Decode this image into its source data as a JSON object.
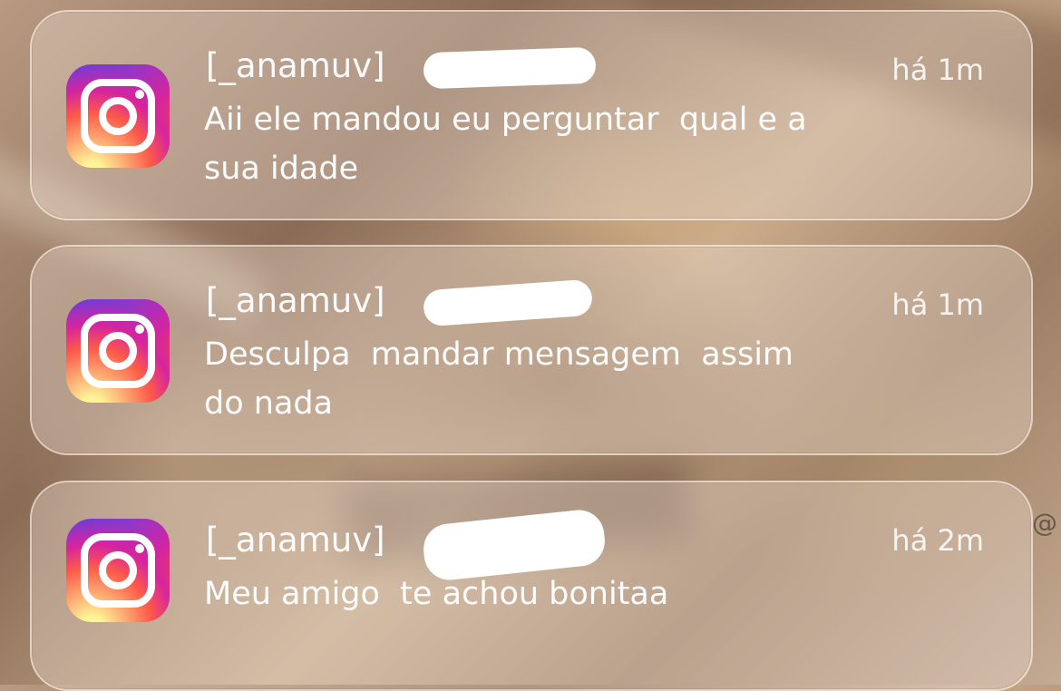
{
  "notifications": [
    {
      "app_icon": "instagram-icon",
      "sender": "[_anamuv]",
      "time": "há 1m",
      "message": "Aii ele mandou eu perguntar  qual e a\nsua idade"
    },
    {
      "app_icon": "instagram-icon",
      "sender": "[_anamuv]",
      "time": "há 1m",
      "message": "Desculpa  mandar mensagem  assim\ndo nada"
    },
    {
      "app_icon": "instagram-icon",
      "sender": "[_anamuv]",
      "time": "há 2m",
      "message": "Meu amigo  te achou bonitaa"
    }
  ],
  "edge_glyph": "@",
  "colors": {
    "instagram_gradient_start": "#6a3dd8",
    "instagram_gradient_mid": "#d6249f",
    "instagram_gradient_end": "#ffb33b",
    "text": "#ffffff"
  }
}
